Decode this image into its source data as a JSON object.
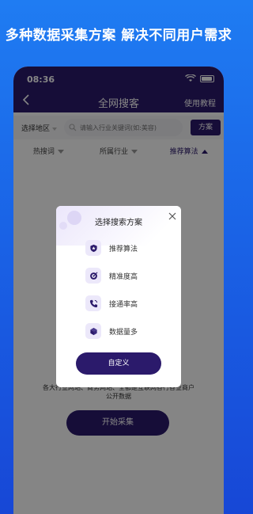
{
  "banner": {
    "text": "多种数据采集方案 解决不同用户需求"
  },
  "status_bar": {
    "time": "08:36"
  },
  "nav": {
    "title": "全网搜客",
    "right_link": "使用教程"
  },
  "search": {
    "region_label": "选择地区",
    "placeholder": "请输入行业关键词(如:美容)",
    "plan_button": "方案"
  },
  "tabs": [
    {
      "label": "热搜词",
      "active": false
    },
    {
      "label": "所属行业",
      "active": false
    },
    {
      "label": "推荐算法",
      "active": true
    }
  ],
  "body": {
    "line1": "数据 … 统、",
    "line2": "各大行业网站、商务网站、全都是互联网各行各业商户",
    "line3": "公开数据",
    "start_button": "开始采集"
  },
  "modal": {
    "title": "选择搜索方案",
    "options": [
      {
        "label": "推荐算法",
        "icon": "shield-icon"
      },
      {
        "label": "精准度高",
        "icon": "target-icon"
      },
      {
        "label": "接通率高",
        "icon": "phone-icon"
      },
      {
        "label": "数据量多",
        "icon": "cube-icon"
      }
    ],
    "custom_button": "自定义"
  },
  "colors": {
    "brand_purple": "#2b1a6b",
    "background_blue": "#1a63e6",
    "icon_bg": "#ece8fa"
  }
}
